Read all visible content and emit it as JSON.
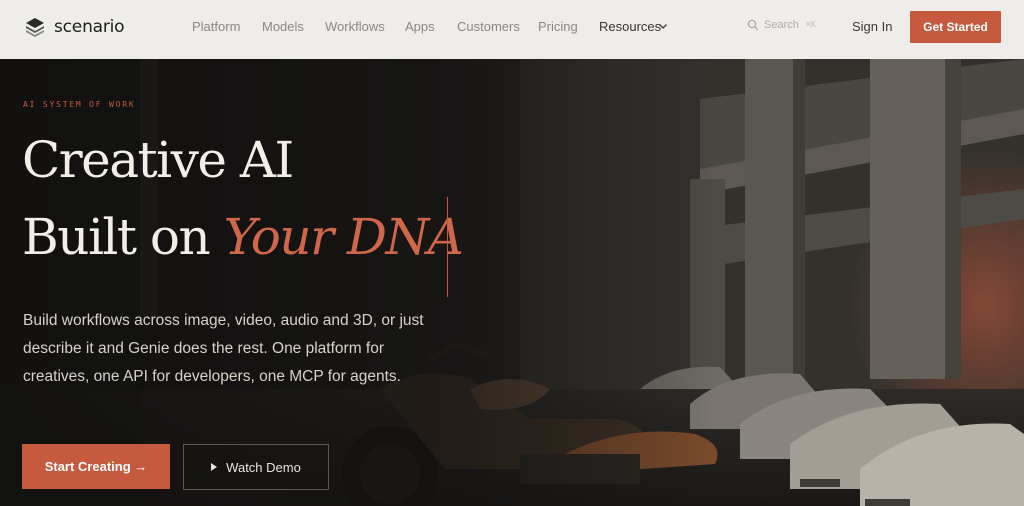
{
  "brand": {
    "name": "scenario"
  },
  "nav": {
    "links": [
      "Platform",
      "Models",
      "Workflows",
      "Apps",
      "Customers",
      "Pricing",
      "Resources"
    ],
    "search_placeholder": "Search",
    "search_shortcut": "⌘K",
    "signin": "Sign In",
    "cta": "Get Started"
  },
  "hero": {
    "eyebrow": "AI SYSTEM OF WORK",
    "headline_line1": "Creative AI",
    "headline_line2_prefix": "Built on ",
    "headline_line2_accent": "Your DNA",
    "description": "Build workflows across image, video, audio and 3D, or just describe it and Genie does the rest. One platform for creatives, one API for developers, one MCP for agents.",
    "primary_button": "Start Creating →",
    "secondary_button": "Watch Demo"
  },
  "colors": {
    "accent": "#c55a3e",
    "nav_bg": "#efede9",
    "hero_bg": "#1a1816"
  },
  "icons": [
    "logo-mark-icon",
    "chevron-down-icon",
    "search-icon",
    "play-icon"
  ]
}
